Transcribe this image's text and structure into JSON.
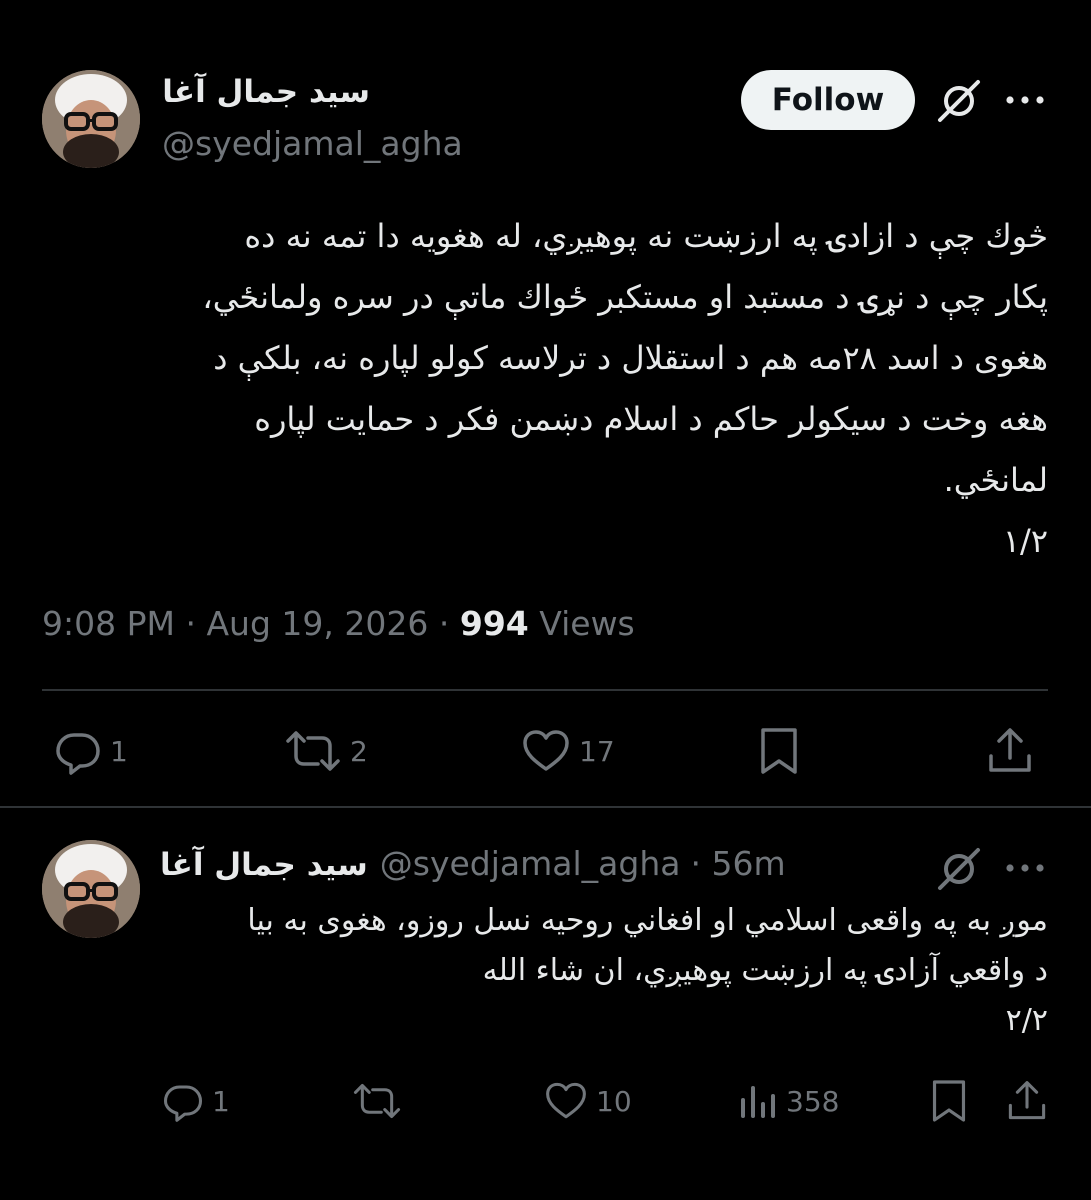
{
  "tweet": {
    "author_name": "سید جمال آغا",
    "author_handle": "@syedjamal_agha",
    "follow_label": "Follow",
    "more_icon": "more-icon",
    "grok_icon": "grok-icon",
    "text_lines": [
      "څوك چې د ازادۍ په ارزښت نه پوهيږي، له هغويه دا تمه نه ده",
      "پکار چې د نړۍ د مستبد او مستکبر ځواك ماتې در سره ولمانځي،",
      "هغوی د اسد ۲۸مه هم د استقلال د ترلاسه کولو لپاره نه، بلکې د",
      "هغه وخت د سیکولر حاکم د اسلام دښمن فکر د حمایت لپاره",
      "لمانځي.",
      "۱/۲"
    ],
    "time": "9:08 PM",
    "sep": "·",
    "date": "Aug 19, 2026",
    "views_count": "994",
    "views_label": "Views",
    "replies": "1",
    "reposts": "2",
    "likes": "17"
  },
  "reply": {
    "author_name": "سید جمال آغا",
    "author_handle": "@syedjamal_agha",
    "time_ago": "· 56m",
    "text_lines": [
      "موږ به په واقعی اسلامي او افغاني روحیه نسل روزو، هغوی به بیا",
      "د واقعي آزادۍ په ارزښت پوهیږي، ان شاء الله",
      "۲/۲"
    ],
    "replies": "1",
    "likes": "10",
    "views": "358"
  }
}
